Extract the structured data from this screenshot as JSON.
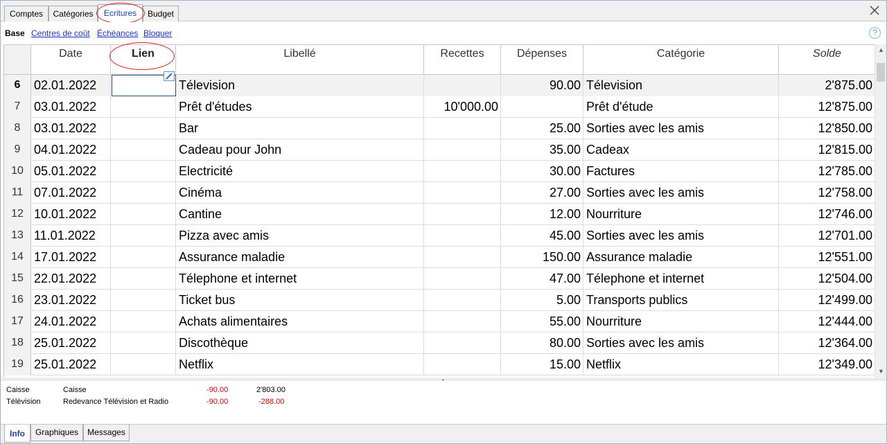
{
  "top_tabs": [
    "Comptes",
    "Catégories",
    "Ecritures",
    "Budget"
  ],
  "active_tab": "Ecritures",
  "sub_views": {
    "current": "Base",
    "links": [
      "Centres de coût",
      "Échéances",
      "Bloquer"
    ]
  },
  "help_label": "?",
  "table": {
    "headers": {
      "date": "Date",
      "lien": "Lien",
      "libelle": "Libellé",
      "recettes": "Recettes",
      "depenses": "Dépenses",
      "categorie": "Catégorie",
      "solde": "Solde"
    },
    "rows": [
      {
        "num": "6",
        "date": "02.01.2022",
        "libelle": "Télevision",
        "recettes": "",
        "depenses": "90.00",
        "categorie": "Télevision",
        "solde": "2'875.00"
      },
      {
        "num": "7",
        "date": "03.01.2022",
        "libelle": "Prêt d'études",
        "recettes": "10'000.00",
        "depenses": "",
        "categorie": "Prêt d'étude",
        "solde": "12'875.00"
      },
      {
        "num": "8",
        "date": "03.01.2022",
        "libelle": "Bar",
        "recettes": "",
        "depenses": "25.00",
        "categorie": "Sorties avec les amis",
        "solde": "12'850.00"
      },
      {
        "num": "9",
        "date": "04.01.2022",
        "libelle": "Cadeau pour John",
        "recettes": "",
        "depenses": "35.00",
        "categorie": "Cadeax",
        "solde": "12'815.00"
      },
      {
        "num": "10",
        "date": "05.01.2022",
        "libelle": "Electricité",
        "recettes": "",
        "depenses": "30.00",
        "categorie": "Factures",
        "solde": "12'785.00"
      },
      {
        "num": "11",
        "date": "07.01.2022",
        "libelle": "Cinéma",
        "recettes": "",
        "depenses": "27.00",
        "categorie": "Sorties avec les amis",
        "solde": "12'758.00"
      },
      {
        "num": "12",
        "date": "10.01.2022",
        "libelle": "Cantine",
        "recettes": "",
        "depenses": "12.00",
        "categorie": "Nourriture",
        "solde": "12'746.00"
      },
      {
        "num": "13",
        "date": "11.01.2022",
        "libelle": "Pizza avec amis",
        "recettes": "",
        "depenses": "45.00",
        "categorie": "Sorties avec les amis",
        "solde": "12'701.00"
      },
      {
        "num": "14",
        "date": "17.01.2022",
        "libelle": "Assurance maladie",
        "recettes": "",
        "depenses": "150.00",
        "categorie": "Assurance maladie",
        "solde": "12'551.00"
      },
      {
        "num": "15",
        "date": "22.01.2022",
        "libelle": "Télephone et internet",
        "recettes": "",
        "depenses": "47.00",
        "categorie": "Télephone et internet",
        "solde": "12'504.00"
      },
      {
        "num": "16",
        "date": "23.01.2022",
        "libelle": "Ticket bus",
        "recettes": "",
        "depenses": "5.00",
        "categorie": "Transports publics",
        "solde": "12'499.00"
      },
      {
        "num": "17",
        "date": "24.01.2022",
        "libelle": "Achats alimentaires",
        "recettes": "",
        "depenses": "55.00",
        "categorie": "Nourriture",
        "solde": "12'444.00"
      },
      {
        "num": "18",
        "date": "25.01.2022",
        "libelle": "Discothèque",
        "recettes": "",
        "depenses": "80.00",
        "categorie": "Sorties avec les amis",
        "solde": "12'364.00"
      },
      {
        "num": "19",
        "date": "25.01.2022",
        "libelle": "Netflix",
        "recettes": "",
        "depenses": "15.00",
        "categorie": "Netflix",
        "solde": "12'349.00"
      }
    ]
  },
  "info_panel": [
    {
      "account": "Caisse",
      "description": "Caisse",
      "amount": "-90.00",
      "balance": "2'803.00"
    },
    {
      "account": "Télévision",
      "description": "Redevance Télévision et Radio",
      "amount": "-90.00",
      "balance": "-288.00"
    }
  ],
  "bottom_tabs": [
    "Info",
    "Graphiques",
    "Messages"
  ],
  "active_bottom_tab": "Info",
  "icons": {
    "close": "close-icon",
    "help": "help-icon",
    "edit": "pencil-edit-icon",
    "scroll_up": "scroll-up-arrow-icon",
    "scroll_down": "scroll-down-arrow-icon"
  },
  "colors": {
    "link": "#1a33cc",
    "active_tab_text": "#1f3fa8",
    "annotation": "#e02020",
    "negative": "#e00000"
  }
}
